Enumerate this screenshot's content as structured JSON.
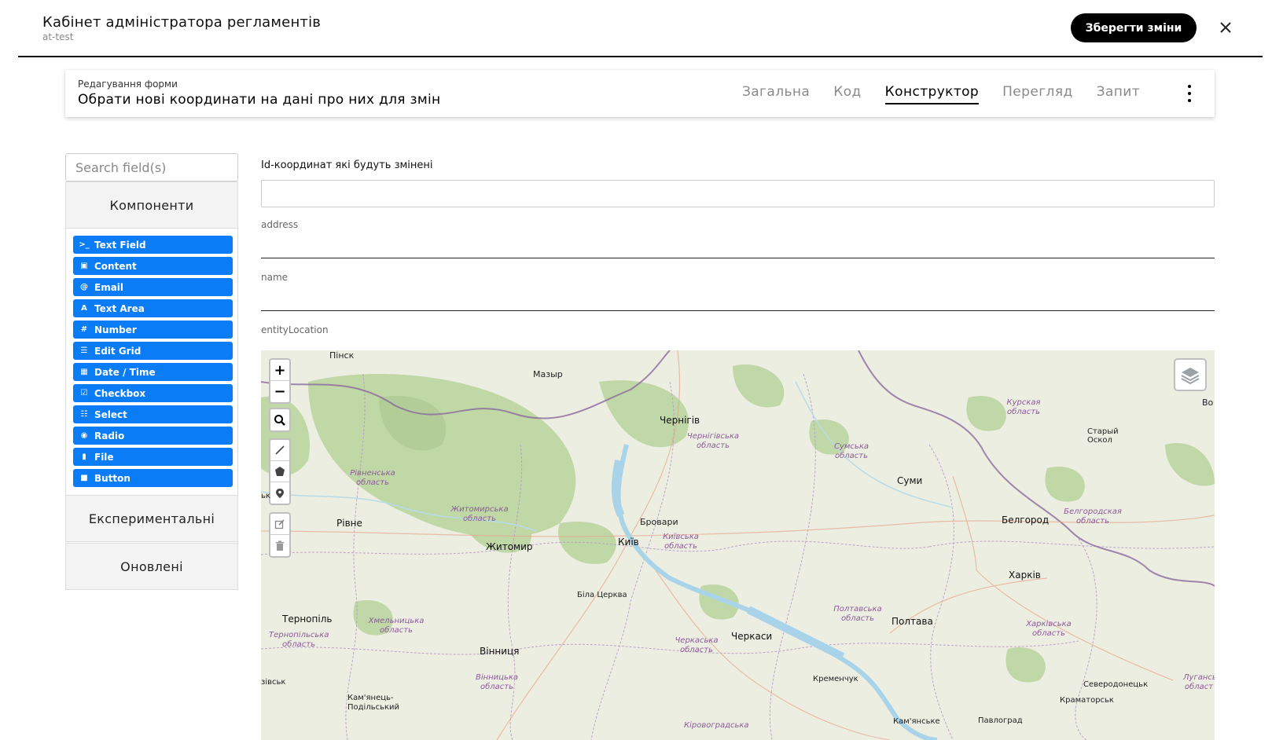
{
  "header": {
    "title": "Кабінет адміністратора регламентів",
    "subtitle": "at-test",
    "save_label": "Зберегти зміни"
  },
  "form_card": {
    "kicker": "Редагування форми",
    "name": "Обрати нові координати на дані про них для змін",
    "tabs": [
      {
        "label": "Загальна",
        "active": false
      },
      {
        "label": "Код",
        "active": false
      },
      {
        "label": "Конструктор",
        "active": true
      },
      {
        "label": "Перегляд",
        "active": false
      },
      {
        "label": "Запит",
        "active": false
      }
    ]
  },
  "sidebar": {
    "search_placeholder": "Search field(s)",
    "groups": {
      "components": "Компоненти",
      "experimental": "Експериментальні",
      "updated": "Оновлені"
    },
    "components": [
      {
        "label": "Text Field",
        "icon": "terminal-icon"
      },
      {
        "label": "Content",
        "icon": "html5-icon"
      },
      {
        "label": "Email",
        "icon": "at-icon"
      },
      {
        "label": "Text Area",
        "icon": "font-icon"
      },
      {
        "label": "Number",
        "icon": "hash-icon"
      },
      {
        "label": "Edit Grid",
        "icon": "tasks-icon"
      },
      {
        "label": "Date / Time",
        "icon": "calendar-icon"
      },
      {
        "label": "Checkbox",
        "icon": "check-square-icon"
      },
      {
        "label": "Select",
        "icon": "th-list-icon"
      },
      {
        "label": "Radio",
        "icon": "dot-circle-icon"
      },
      {
        "label": "File",
        "icon": "file-icon"
      },
      {
        "label": "Button",
        "icon": "stop-icon"
      }
    ]
  },
  "form_fields": {
    "id_label": "Id-координат які будуть змінені",
    "address_label": "address",
    "name_label": "name",
    "location_label": "entityLocation"
  },
  "map": {
    "controls": [
      "+",
      "−"
    ],
    "cities": [
      {
        "name": "Пінск"
      },
      {
        "name": "Мазыр"
      },
      {
        "name": "Чернігів"
      },
      {
        "name": "Суми"
      },
      {
        "name": "Старый Оскол"
      },
      {
        "name": "Рівне"
      },
      {
        "name": "Житомир"
      },
      {
        "name": "Бровари"
      },
      {
        "name": "Київ"
      },
      {
        "name": "Белгород"
      },
      {
        "name": "Харків"
      },
      {
        "name": "Біла Церква"
      },
      {
        "name": "Тернопіль"
      },
      {
        "name": "Полтава"
      },
      {
        "name": "Черкаси"
      },
      {
        "name": "Вінниця"
      },
      {
        "name": "Кременчук"
      },
      {
        "name": "Северодонецьк"
      },
      {
        "name": "Краматорськ"
      },
      {
        "name": "Кам'янець-Подільський"
      },
      {
        "name": "Кам'янське"
      },
      {
        "name": "Павлоград"
      },
      {
        "name": "Во"
      },
      {
        "name": "ьк"
      },
      {
        "name": "зівськ"
      }
    ],
    "regions": [
      "Курская область",
      "Чернігівська область",
      "Сумська область",
      "Рівненська область",
      "Житомирська область",
      "Київська область",
      "Белгородская область",
      "Хмельницька область",
      "Тернопільська область",
      "Полтавська область",
      "Черкаська область",
      "Харківська область",
      "Вінницька область",
      "Луганська област",
      "Кіровоградська"
    ]
  }
}
